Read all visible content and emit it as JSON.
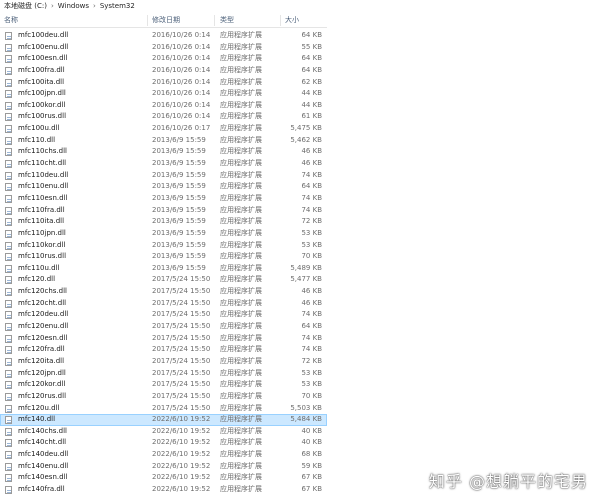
{
  "breadcrumb": [
    "本地磁盘 (C:)",
    "Windows",
    "System32"
  ],
  "columns": {
    "name": "名称",
    "date": "修改日期",
    "type": "类型",
    "size": "大小"
  },
  "files": [
    {
      "name": "mfc100deu.dll",
      "date": "2016/10/26 0:14",
      "type": "应用程序扩展",
      "size": "64 KB"
    },
    {
      "name": "mfc100enu.dll",
      "date": "2016/10/26 0:14",
      "type": "应用程序扩展",
      "size": "55 KB"
    },
    {
      "name": "mfc100esn.dll",
      "date": "2016/10/26 0:14",
      "type": "应用程序扩展",
      "size": "64 KB"
    },
    {
      "name": "mfc100fra.dll",
      "date": "2016/10/26 0:14",
      "type": "应用程序扩展",
      "size": "64 KB"
    },
    {
      "name": "mfc100ita.dll",
      "date": "2016/10/26 0:14",
      "type": "应用程序扩展",
      "size": "62 KB"
    },
    {
      "name": "mfc100jpn.dll",
      "date": "2016/10/26 0:14",
      "type": "应用程序扩展",
      "size": "44 KB"
    },
    {
      "name": "mfc100kor.dll",
      "date": "2016/10/26 0:14",
      "type": "应用程序扩展",
      "size": "44 KB"
    },
    {
      "name": "mfc100rus.dll",
      "date": "2016/10/26 0:14",
      "type": "应用程序扩展",
      "size": "61 KB"
    },
    {
      "name": "mfc100u.dll",
      "date": "2016/10/26 0:17",
      "type": "应用程序扩展",
      "size": "5,475 KB"
    },
    {
      "name": "mfc110.dll",
      "date": "2013/6/9 15:59",
      "type": "应用程序扩展",
      "size": "5,462 KB"
    },
    {
      "name": "mfc110chs.dll",
      "date": "2013/6/9 15:59",
      "type": "应用程序扩展",
      "size": "46 KB"
    },
    {
      "name": "mfc110cht.dll",
      "date": "2013/6/9 15:59",
      "type": "应用程序扩展",
      "size": "46 KB"
    },
    {
      "name": "mfc110deu.dll",
      "date": "2013/6/9 15:59",
      "type": "应用程序扩展",
      "size": "74 KB"
    },
    {
      "name": "mfc110enu.dll",
      "date": "2013/6/9 15:59",
      "type": "应用程序扩展",
      "size": "64 KB"
    },
    {
      "name": "mfc110esn.dll",
      "date": "2013/6/9 15:59",
      "type": "应用程序扩展",
      "size": "74 KB"
    },
    {
      "name": "mfc110fra.dll",
      "date": "2013/6/9 15:59",
      "type": "应用程序扩展",
      "size": "74 KB"
    },
    {
      "name": "mfc110ita.dll",
      "date": "2013/6/9 15:59",
      "type": "应用程序扩展",
      "size": "72 KB"
    },
    {
      "name": "mfc110jpn.dll",
      "date": "2013/6/9 15:59",
      "type": "应用程序扩展",
      "size": "53 KB"
    },
    {
      "name": "mfc110kor.dll",
      "date": "2013/6/9 15:59",
      "type": "应用程序扩展",
      "size": "53 KB"
    },
    {
      "name": "mfc110rus.dll",
      "date": "2013/6/9 15:59",
      "type": "应用程序扩展",
      "size": "70 KB"
    },
    {
      "name": "mfc110u.dll",
      "date": "2013/6/9 15:59",
      "type": "应用程序扩展",
      "size": "5,489 KB"
    },
    {
      "name": "mfc120.dll",
      "date": "2017/5/24 15:50",
      "type": "应用程序扩展",
      "size": "5,477 KB"
    },
    {
      "name": "mfc120chs.dll",
      "date": "2017/5/24 15:50",
      "type": "应用程序扩展",
      "size": "46 KB"
    },
    {
      "name": "mfc120cht.dll",
      "date": "2017/5/24 15:50",
      "type": "应用程序扩展",
      "size": "46 KB"
    },
    {
      "name": "mfc120deu.dll",
      "date": "2017/5/24 15:50",
      "type": "应用程序扩展",
      "size": "74 KB"
    },
    {
      "name": "mfc120enu.dll",
      "date": "2017/5/24 15:50",
      "type": "应用程序扩展",
      "size": "64 KB"
    },
    {
      "name": "mfc120esn.dll",
      "date": "2017/5/24 15:50",
      "type": "应用程序扩展",
      "size": "74 KB"
    },
    {
      "name": "mfc120fra.dll",
      "date": "2017/5/24 15:50",
      "type": "应用程序扩展",
      "size": "74 KB"
    },
    {
      "name": "mfc120ita.dll",
      "date": "2017/5/24 15:50",
      "type": "应用程序扩展",
      "size": "72 KB"
    },
    {
      "name": "mfc120jpn.dll",
      "date": "2017/5/24 15:50",
      "type": "应用程序扩展",
      "size": "53 KB"
    },
    {
      "name": "mfc120kor.dll",
      "date": "2017/5/24 15:50",
      "type": "应用程序扩展",
      "size": "53 KB"
    },
    {
      "name": "mfc120rus.dll",
      "date": "2017/5/24 15:50",
      "type": "应用程序扩展",
      "size": "70 KB"
    },
    {
      "name": "mfc120u.dll",
      "date": "2017/5/24 15:50",
      "type": "应用程序扩展",
      "size": "5,503 KB"
    },
    {
      "name": "mfc140.dll",
      "date": "2022/6/10 19:52",
      "type": "应用程序扩展",
      "size": "5,484 KB",
      "selected": true
    },
    {
      "name": "mfc140chs.dll",
      "date": "2022/6/10 19:52",
      "type": "应用程序扩展",
      "size": "40 KB"
    },
    {
      "name": "mfc140cht.dll",
      "date": "2022/6/10 19:52",
      "type": "应用程序扩展",
      "size": "40 KB"
    },
    {
      "name": "mfc140deu.dll",
      "date": "2022/6/10 19:52",
      "type": "应用程序扩展",
      "size": "68 KB"
    },
    {
      "name": "mfc140enu.dll",
      "date": "2022/6/10 19:52",
      "type": "应用程序扩展",
      "size": "59 KB"
    },
    {
      "name": "mfc140esn.dll",
      "date": "2022/6/10 19:52",
      "type": "应用程序扩展",
      "size": "67 KB"
    },
    {
      "name": "mfc140fra.dll",
      "date": "2022/6/10 19:52",
      "type": "应用程序扩展",
      "size": "67 KB"
    }
  ],
  "watermark": "知乎 @想躺平的宅男"
}
